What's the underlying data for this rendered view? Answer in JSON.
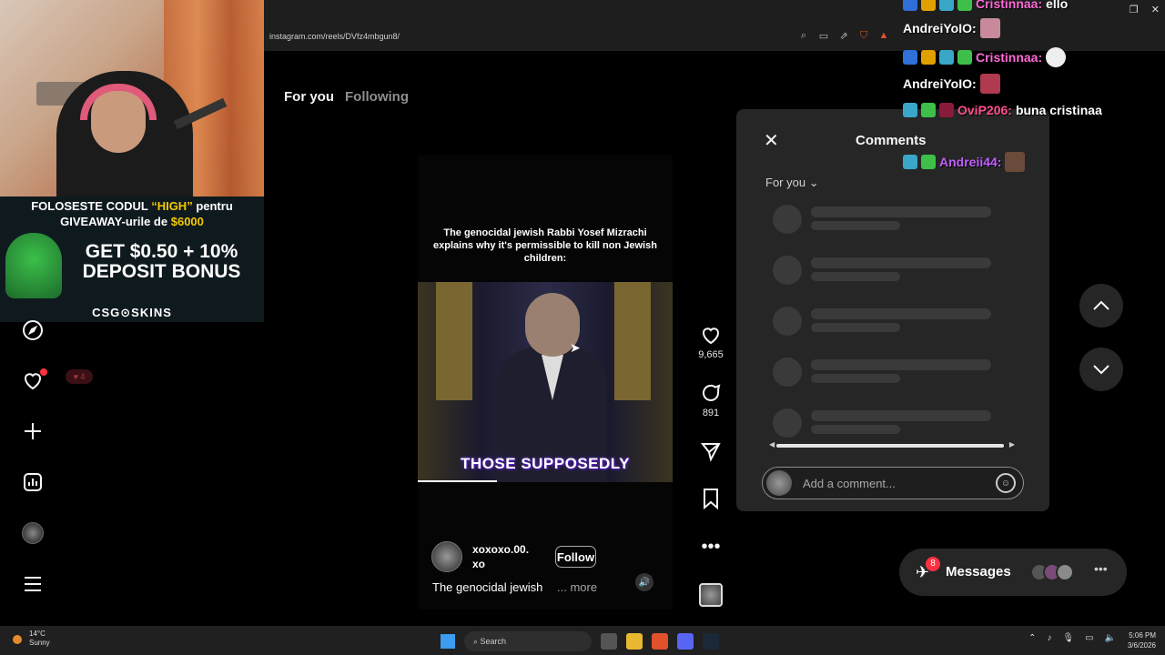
{
  "browser": {
    "url": "instagram.com/reels/DVfz4mbgun8/"
  },
  "feed_tabs": {
    "for_you": "For you",
    "following": "Following"
  },
  "stream_overlay": {
    "promo_line1_pre": "FOLOSESTE CODUL",
    "promo_code": "“HIGH”",
    "promo_line1_post": "pentru",
    "promo_line2_pre": "GIVEAWAY-urile de",
    "promo_amount": "$6000",
    "bonus_line1": "GET $0.50 + 10%",
    "bonus_line2": "DEPOSIT BONUS",
    "brand": "CSG⊙SKINS"
  },
  "nav": {
    "notif_count": "4"
  },
  "reel": {
    "overlay_caption": "The genocidal jewish Rabbi Yosef Mizrachi explains why it's permissible to  kill non Jewish children:",
    "subtitle": "THOSE SUPPOSEDLY",
    "username": "xoxoxo.00.\nxo",
    "follow_label": "Follow",
    "description": "The genocidal jewish",
    "more_label": "... more",
    "progress": 0.31
  },
  "actions": {
    "likes": "9,665",
    "comments": "891"
  },
  "comments_panel": {
    "title": "Comments",
    "sort_label": "For you",
    "input_placeholder": "Add a comment..."
  },
  "messages": {
    "label": "Messages",
    "badge": "8"
  },
  "chat": [
    {
      "user": "Cristinnaa:",
      "text": "ello"
    },
    {
      "user": "AndreiYoIO:",
      "text": ""
    },
    {
      "user": "Cristinnaa:",
      "text": ""
    },
    {
      "user": "AndreiYoIO:",
      "text": ""
    },
    {
      "user": "OviP206:",
      "text": "buna cristinaa"
    },
    {
      "user": "Andreii44:",
      "text": ""
    }
  ],
  "taskbar": {
    "temp": "14°C",
    "weather": "Sunny",
    "search": "Search",
    "time": "5:06 PM",
    "date": "3/6/2026"
  },
  "colors": {
    "background": "#000000",
    "panel": "#262626",
    "notification_red": "#ff3040",
    "subtitle_glow": "#6a2bd9"
  }
}
